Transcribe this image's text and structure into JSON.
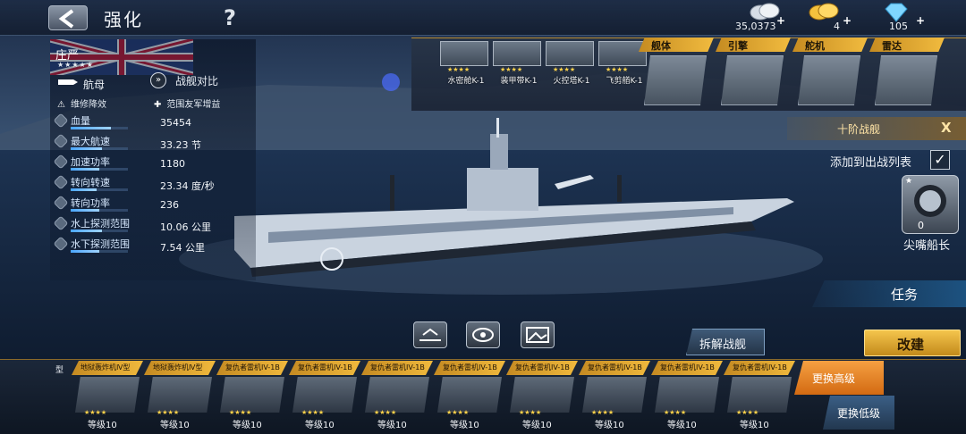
{
  "header": {
    "title": "强化",
    "help_glyph": "?",
    "resources": [
      {
        "icon": "silver-coins-icon",
        "value": "35,0373"
      },
      {
        "icon": "gold-coins-icon",
        "value": "4"
      },
      {
        "icon": "diamond-icon",
        "value": "105"
      }
    ]
  },
  "ship": {
    "name": "庄严",
    "stars": "★★★★★",
    "type": "航母",
    "compare": "战舰对比",
    "perks": [
      "维修降效",
      "范围友军增益"
    ],
    "stats": [
      {
        "name": "血量",
        "value": "35454",
        "level": 0.7
      },
      {
        "name": "最大航速",
        "value": "33.23 节",
        "level": 0.55
      },
      {
        "name": "加速功率",
        "value": "1180",
        "level": 0.5
      },
      {
        "name": "转向转速",
        "value": "23.34 度/秒",
        "level": 0.45
      },
      {
        "name": "转向功率",
        "value": "236",
        "level": 0.5
      },
      {
        "name": "水上探测范围",
        "value": "10.06 公里",
        "level": 0.55
      },
      {
        "name": "水下探测范围",
        "value": "7.54 公里",
        "level": 0.5
      }
    ]
  },
  "equipment": [
    {
      "name": "水密舱K-1",
      "stars": "★★★★"
    },
    {
      "name": "装甲带K-1",
      "stars": "★★★★"
    },
    {
      "name": "火控塔K-1",
      "stars": "★★★★"
    },
    {
      "name": "飞剪艏K-1",
      "stars": "★★★★"
    }
  ],
  "parts": [
    {
      "label": "舰体",
      "icon": "hull-icon"
    },
    {
      "label": "引擎",
      "icon": "engine-icon"
    },
    {
      "label": "舵机",
      "icon": "rudder-icon"
    },
    {
      "label": "雷达",
      "icon": "radar-icon"
    }
  ],
  "tier": {
    "label": "十阶战舰",
    "close": "X"
  },
  "fleet": {
    "label": "添加到出战列表",
    "checked": "✓"
  },
  "captain": {
    "name": "尖嘴船长",
    "level": "0",
    "star": "★"
  },
  "actions": {
    "task": "任务",
    "dismantle": "拆解战舰",
    "refit": "改建",
    "swap_high": "更换高级",
    "swap_low": "更换低级"
  },
  "tray": {
    "cut_label": "型",
    "aircraft": [
      {
        "name": "地狱轰炸机Ⅳ型",
        "stars": "★★★★",
        "level": "等级10"
      },
      {
        "name": "地狱轰炸机Ⅳ型",
        "stars": "★★★★",
        "level": "等级10"
      },
      {
        "name": "复仇者雷机IV-1B",
        "stars": "★★★★",
        "level": "等级10"
      },
      {
        "name": "复仇者雷机IV-1B",
        "stars": "★★★★",
        "level": "等级10"
      },
      {
        "name": "复仇者雷机IV-1B",
        "stars": "★★★★",
        "level": "等级10"
      },
      {
        "name": "复仇者雷机IV-1B",
        "stars": "★★★★",
        "level": "等级10"
      },
      {
        "name": "复仇者雷机IV-1B",
        "stars": "★★★★",
        "level": "等级10"
      },
      {
        "name": "复仇者雷机IV-1B",
        "stars": "★★★★",
        "level": "等级10"
      },
      {
        "name": "复仇者雷机IV-1B",
        "stars": "★★★★",
        "level": "等级10"
      },
      {
        "name": "复仇者雷机IV-1B",
        "stars": "★★★★",
        "level": "等级10"
      }
    ]
  },
  "colors": {
    "accent_gold": "#f0b93d",
    "stat_bar": "#4aa6ff",
    "swap_high": "#e07f22",
    "swap_low": "#2e4c6d"
  }
}
